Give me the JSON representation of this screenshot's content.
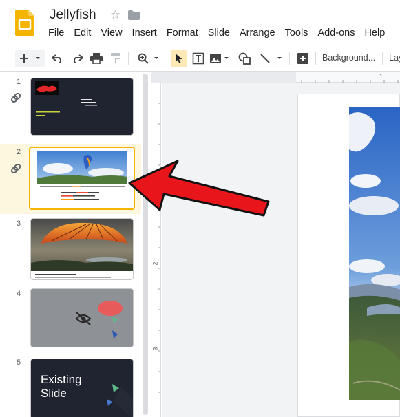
{
  "doc": {
    "title": "Jellyfish",
    "star_icon": "star-icon",
    "folder_icon": "folder-icon"
  },
  "menu": [
    "File",
    "Edit",
    "View",
    "Insert",
    "Format",
    "Slide",
    "Arrange",
    "Tools",
    "Add-ons",
    "Help"
  ],
  "toolbar": {
    "background_label": "Background...",
    "layout_label": "Lay",
    "icons": [
      "plus-icon",
      "undo-icon",
      "redo-icon",
      "print-icon",
      "paint-format-icon",
      "zoom-icon",
      "select-cursor-icon",
      "textbox-icon",
      "image-icon",
      "shape-icon",
      "line-icon",
      "add-comment-icon"
    ]
  },
  "ruler": {
    "top_number": "1",
    "left_numbers": [
      "2",
      "3"
    ]
  },
  "slides": [
    {
      "number": "1",
      "linked": true
    },
    {
      "number": "2",
      "linked": true,
      "selected": true,
      "caption_line1": "Gletschmuntaub - Mostat - September 2011",
      "caption_line2": "neues Alpenbuch Englisch",
      "caption_line3": "Colombes im September",
      "caption_line4": "Marokko - Leben im Norden"
    },
    {
      "number": "3",
      "linked": false
    },
    {
      "number": "4",
      "linked": false,
      "hidden_icon": "eye-off-icon"
    },
    {
      "number": "5",
      "linked": false,
      "text": "Existing Slide",
      "line1": "Existing",
      "line2": "Slide"
    }
  ],
  "colors": {
    "accent": "#f4b400",
    "selected_bg": "#fef7e0",
    "arrow": "#e8161b",
    "slide_dark": "#1f2430"
  },
  "annotation": {
    "arrow": "red-arrow-pointing-to-slide-2"
  }
}
